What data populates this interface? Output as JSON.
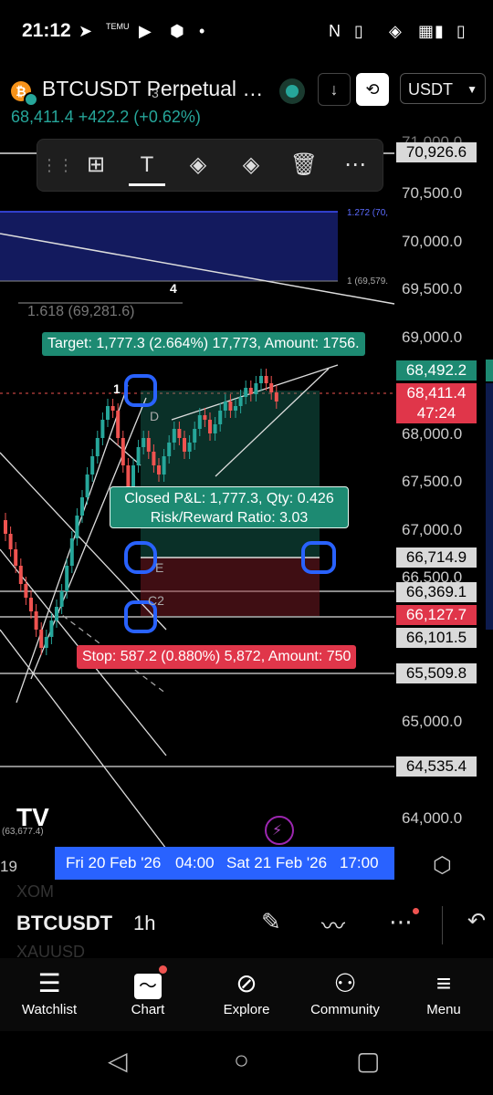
{
  "status_bar": {
    "time": "21:12",
    "temu": "TEMU"
  },
  "header": {
    "symbol": "BTCUSDT Perpetual …",
    "last": "68,411.4",
    "change": "+422.2 (+0.62%)",
    "currency": "USDT"
  },
  "price_axis": {
    "labels": [
      "71,000.0",
      "70,500.0",
      "70,000.0",
      "69,500.0",
      "69,000.0",
      "68,000.0",
      "67,500.0",
      "67,000.0",
      "66,500.0",
      "65,000.0",
      "64,000.0"
    ],
    "boxes": [
      {
        "value": "70,926.6",
        "bg": "#d9d9d9",
        "fg": "#000"
      },
      {
        "value": "68,492.2",
        "bg": "#1d8a72",
        "fg": "#fff"
      },
      {
        "value": "68,411.4",
        "bg": "#e0364a",
        "fg": "#fff"
      },
      {
        "value": "47:24",
        "bg": "#e0364a",
        "fg": "#fff"
      },
      {
        "value": "66,714.9",
        "bg": "#d9d9d9",
        "fg": "#000"
      },
      {
        "value": "66,369.1",
        "bg": "#d9d9d9",
        "fg": "#000"
      },
      {
        "value": "66,127.7",
        "bg": "#e0364a",
        "fg": "#fff"
      },
      {
        "value": "66,101.5",
        "bg": "#d9d9d9",
        "fg": "#000"
      },
      {
        "value": "65,509.8",
        "bg": "#d9d9d9",
        "fg": "#000"
      },
      {
        "value": "64,535.4",
        "bg": "#d9d9d9",
        "fg": "#000"
      }
    ]
  },
  "annotations": {
    "fib_1272": "1.272 (70,",
    "fib_1": "1 (69,579.",
    "fib_1618": "1.618 (69,281.6)",
    "wave_3": "3",
    "wave_4": "4",
    "wave_1": "1",
    "pt_D": "D",
    "pt_E": "E",
    "pt_C2": "C2",
    "low_label": "(63,677.4)",
    "left_date": "19"
  },
  "position": {
    "target": "Target: 1,777.3 (2.664%) 17,773, Amount: 1756.",
    "stop": "Stop: 587.2 (0.880%) 5,872, Amount: 750",
    "pnl_line1": "Closed P&L: 1,777.3, Qty: 0.426",
    "pnl_line2": "Risk/Reward Ratio: 3.03"
  },
  "time_axis": {
    "t1": "Fri 20 Feb '26",
    "t2": "04:00",
    "t3": "Sat 21 Feb '26",
    "t4": "17:00"
  },
  "bottom_toolbar": {
    "symbol": "BTCUSDT",
    "interval": "1h",
    "ghost_above": "XOM",
    "ghost_below": "XAUUSD"
  },
  "nav": {
    "items": [
      "Watchlist",
      "Chart",
      "Explore",
      "Community",
      "Menu"
    ]
  },
  "colors": {
    "green": "#26a69a",
    "red": "#ef5350",
    "accent": "#2962ff"
  }
}
